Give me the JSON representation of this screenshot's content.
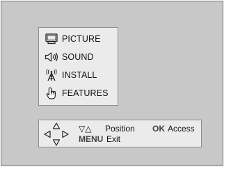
{
  "main_menu": {
    "items": [
      {
        "label": "PICTURE",
        "icon": "tv-screen-icon"
      },
      {
        "label": "SOUND",
        "icon": "speaker-icon"
      },
      {
        "label": "INSTALL",
        "icon": "antenna-icon"
      },
      {
        "label": "FEATURES",
        "icon": "hand-pointer-icon"
      }
    ]
  },
  "help": {
    "dpad_icon": "dpad-icon",
    "arrows": "▽△",
    "position_label": "Position",
    "ok_key": "OK",
    "access_label": "Access",
    "menu_key": "MENU",
    "exit_label": "Exit"
  },
  "colors": {
    "screen_background": "#c8c8c8",
    "panel_background": "#ebebeb",
    "panel_border": "#8c8c8c"
  }
}
